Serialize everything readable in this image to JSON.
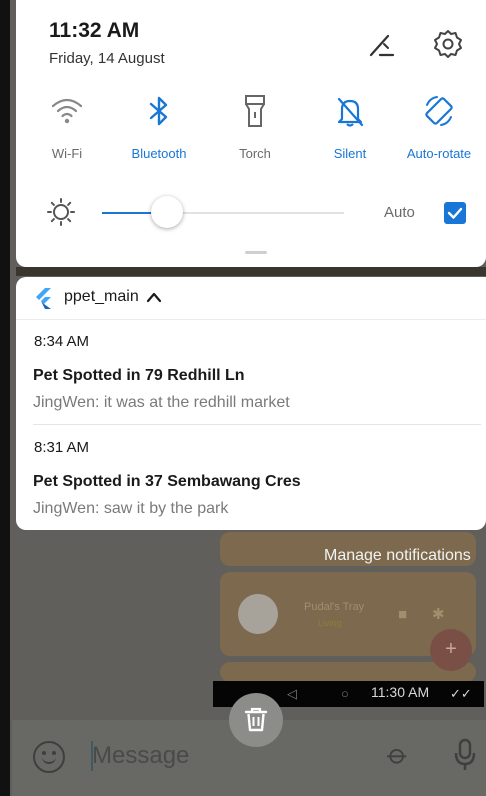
{
  "status": {
    "time": "11:32 AM",
    "date": "Friday, 14 August"
  },
  "quick_tiles": [
    {
      "label": "Wi-Fi",
      "icon": "wifi-icon",
      "active": false
    },
    {
      "label": "Bluetooth",
      "icon": "bluetooth-icon",
      "active": true
    },
    {
      "label": "Torch",
      "icon": "torch-icon",
      "active": false
    },
    {
      "label": "Silent",
      "icon": "silent-icon",
      "active": true
    },
    {
      "label": "Auto-rotate",
      "icon": "auto-rotate-icon",
      "active": true
    }
  ],
  "brightness": {
    "level": 0.27,
    "auto_label": "Auto",
    "auto_checked": true
  },
  "notification": {
    "app_name": "ppet_main",
    "items": [
      {
        "time": "8:34 AM",
        "title": "Pet Spotted in 79 Redhill Ln",
        "body": "JingWen: it was at the redhill market"
      },
      {
        "time": "8:31 AM",
        "title": "Pet Spotted in 37 Sembawang Cres",
        "body": "JingWen: saw it by the park"
      }
    ]
  },
  "manage_label": "Manage notifications",
  "background_app": {
    "card_name": "Pudal's Tray",
    "card_status": "Living",
    "nav_time": "11:30 AM",
    "message_placeholder": "Message"
  },
  "colors": {
    "accent": "#1877d6",
    "panel": "#ffffff",
    "flutter_blue": "#42a5f5"
  }
}
